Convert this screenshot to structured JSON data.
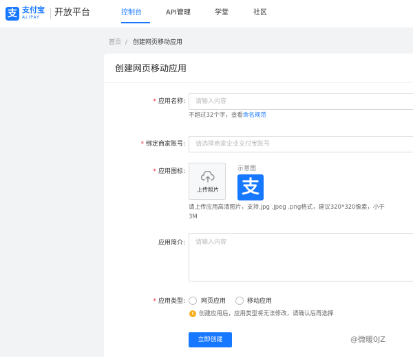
{
  "header": {
    "logo_glyph": "支",
    "logo_text": "支付宝",
    "logo_sub": "ALIPAY",
    "platform": "开放平台",
    "nav": [
      {
        "label": "控制台",
        "active": true
      },
      {
        "label": "API管理",
        "active": false
      },
      {
        "label": "学堂",
        "active": false
      },
      {
        "label": "社区",
        "active": false
      }
    ]
  },
  "breadcrumb": {
    "home": "首页",
    "separator": "/",
    "current": "创建网页移动应用"
  },
  "form": {
    "title": "创建网页移动应用",
    "app_name": {
      "required_mark": "*",
      "label": "应用名称:",
      "placeholder": "请输入内容",
      "help_prefix": "不超过32个字，查看",
      "help_link": "命名规范"
    },
    "merchant": {
      "required_mark": "*",
      "label": "绑定商家账号:",
      "placeholder": "请选择商家企业支付宝账号"
    },
    "icon": {
      "required_mark": "*",
      "label": "应用图标:",
      "upload_label": "上传照片",
      "sample_label": "示意图",
      "sample_glyph": "支",
      "help_line1": "请上传应用高清图片，支持.jpg .jpeg .png格式，建议320*320像素，小于",
      "help_line2": "3M"
    },
    "intro": {
      "label": "应用简介:",
      "placeholder": "请输入内容"
    },
    "type": {
      "required_mark": "*",
      "label": "应用类型:",
      "options": [
        "网页应用",
        "移动应用"
      ],
      "warning_icon": "!",
      "warning": "创建应用后，应用类型将无法修改，请确认后再选择"
    },
    "submit_label": "立即创建"
  },
  "watermark": "@微暖0JZ",
  "colors": {
    "primary": "#1677ff",
    "required": "#f5222d",
    "warning": "#faad14"
  }
}
